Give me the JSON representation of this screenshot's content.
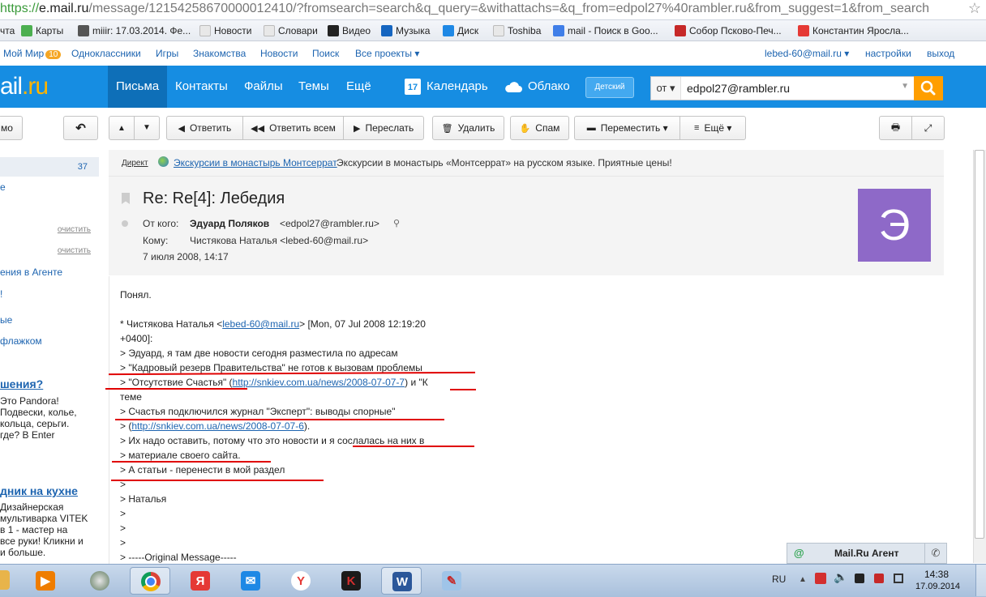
{
  "browser": {
    "url_scheme": "https://",
    "url_host": "e.mail.ru",
    "url_rest": "/message/12154258670000012410/?fromsearch=search&q_query=&withattachs=&q_from=edpol27%40rambler.ru&from_suggest=1&from_search"
  },
  "bookmarks": [
    {
      "label": "чта",
      "color": "#6aa1d8"
    },
    {
      "label": "Карты",
      "color": "#4caf50"
    },
    {
      "label": "miiir: 17.03.2014. Фе...",
      "color": "#555555"
    },
    {
      "label": "Новости",
      "color": "#e8e8e8"
    },
    {
      "label": "Словари",
      "color": "#e8e8e8"
    },
    {
      "label": "Видео",
      "color": "#222222"
    },
    {
      "label": "Музыка",
      "color": "#1565c0"
    },
    {
      "label": "Диск",
      "color": "#1e88e5"
    },
    {
      "label": "Toshiba",
      "color": "#e8e8e8"
    },
    {
      "label": "mail - Поиск в Goo...",
      "color": "#3f7ee8"
    },
    {
      "label": "Собор Псково-Печ...",
      "color": "#c62828"
    },
    {
      "label": "Константин Яросла...",
      "color": "#e53935"
    }
  ],
  "portal": {
    "moi_mir": "Мой Мир",
    "moi_mir_count": "10",
    "links": [
      "Одноклассники",
      "Игры",
      "Знакомства",
      "Новости",
      "Поиск",
      "Все проекты ▾"
    ],
    "user_email": "lebed-60@mail.ru ▾",
    "settings": "настройки",
    "logout": "выход"
  },
  "header": {
    "logo_a": "ail",
    "logo_b": ".ru",
    "nav": [
      "Письма",
      "Контакты",
      "Файлы",
      "Темы",
      "Ещё"
    ],
    "calendar_day": "17",
    "calendar": "Календарь",
    "cloud": "Облако",
    "kids": "Детский",
    "search_from": "от ▾",
    "search_value": "edpol27@rambler.ru"
  },
  "toolbar": {
    "left_button": "мо",
    "reply": "Ответить",
    "reply_all": "Ответить всем",
    "forward": "Переслать",
    "delete": "Удалить",
    "spam": "Спам",
    "move": "Переместить ▾",
    "more": "Ещё ▾"
  },
  "sidebar": {
    "inbox_count": "37",
    "item_e": "е",
    "clear1": "очистить",
    "clear2": "очистить",
    "agent": "ения в Агенте",
    "item_excl": "!",
    "item_ye": "ые",
    "flag": "флажком",
    "ad1_title": "шения?",
    "ad1_lines": [
      "Это Pandora!",
      "Подвески, колье,",
      "кольца, серьги.",
      "где? В Enter"
    ],
    "ad2_title": "дник на кухне",
    "ad2_lines": [
      "Дизайнерская",
      "мультиварка VITEK",
      "в 1 - мастер на",
      "все руки! Кликни и",
      "и больше."
    ]
  },
  "direct": {
    "label": "Директ",
    "link": "Экскурсии в монастырь Монтсеррат",
    "text": "Экскурсии в монастырь «Монтсеррат» на русском языке. Приятные цены!"
  },
  "message": {
    "subject": "Re: Re[4]: Лебедия",
    "from_label": "От кого:",
    "from_name": "Эдуард Поляков",
    "from_email": "<edpol27@rambler.ru>",
    "to_label": "Кому:",
    "to_value": "Чистякова Наталья <lebed-60@mail.ru>",
    "date": "7 июля 2008, 14:17",
    "avatar_letter": "Э",
    "body": {
      "l1": "Понял.",
      "l2a": "* Чистякова Наталья <",
      "l2link": "lebed-60@mail.ru",
      "l2b": "> [Mon, 07 Jul 2008 12:19:20",
      "l3": "+0400]:",
      "l4": "> Эдуард, я там две новости сегодня разместила по адресам",
      "l5": "> \"Кадровый резерв Правительства\" не готов к вызовам проблемы",
      "l6a": "> \"Отсутствие Счастья\" (",
      "l6link": "http://snkiev.com.ua/news/2008-07-07-7",
      "l6b": ") и \"К",
      "l7": "теме",
      "l8": "> Счастья подключился журнал \"Эксперт\": выводы спорные\"",
      "l9a": "> (",
      "l9link": "http://snkiev.com.ua/news/2008-07-07-6",
      "l9b": ").",
      "l10": "> Их надо оставить, потому что это новости и я сослалась на них в",
      "l11": "> материале своего сайта.",
      "l12": "> А статьи - перенести в мой раздел",
      "l13": ">",
      "l14": "> Наталья",
      "l15": ">",
      "l16": ">",
      "l17": ">",
      "l18": "> -----Original Message-----"
    }
  },
  "agent": {
    "label": "Mail.Ru Агент"
  },
  "taskbar": {
    "lang": "RU",
    "time": "14:38",
    "date": "17.09.2014"
  }
}
